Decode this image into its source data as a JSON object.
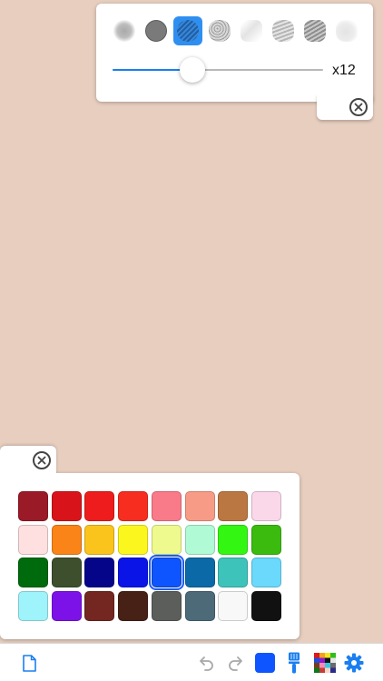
{
  "brush_panel": {
    "brushes": [
      {
        "name": "soft-airbrush-icon"
      },
      {
        "name": "hard-round-brush-icon"
      },
      {
        "name": "textured-round-brush-icon",
        "selected": true
      },
      {
        "name": "sponge-brush-icon"
      },
      {
        "name": "light-chalk-brush-icon"
      },
      {
        "name": "dry-brush-icon"
      },
      {
        "name": "charcoal-brush-icon"
      },
      {
        "name": "blender-brush-icon"
      }
    ],
    "size": 0.38,
    "size_label": "x12",
    "accent_color": "#1a7ff0"
  },
  "color_panel": {
    "selected_color": "#0f55ff",
    "swatches": [
      [
        "#9b1a27",
        "#d8141a",
        "#ee1c1c",
        "#f72d20",
        "#f97a89",
        "#f89b86",
        "#bb7742",
        "#fad8ea"
      ],
      [
        "#fde0df",
        "#fa8417",
        "#fbc41c",
        "#fbf71e",
        "#eefa8d",
        "#b0fad5",
        "#33f713",
        "#3bbb0d"
      ],
      [
        "#006b0c",
        "#3d4f2d",
        "#05058a",
        "#0a14e6",
        "#0f55ff",
        "#0b69a7",
        "#3ec3bb",
        "#6ad9fb"
      ],
      [
        "#9ff3fa",
        "#7d12e8",
        "#742620",
        "#472115",
        "#5b5e5b",
        "#4c6a78",
        "#f8f8f8",
        "#111111"
      ]
    ]
  },
  "toolbar": {
    "accent_color": "#1a7ff0",
    "current_color": "#0f55ff"
  }
}
